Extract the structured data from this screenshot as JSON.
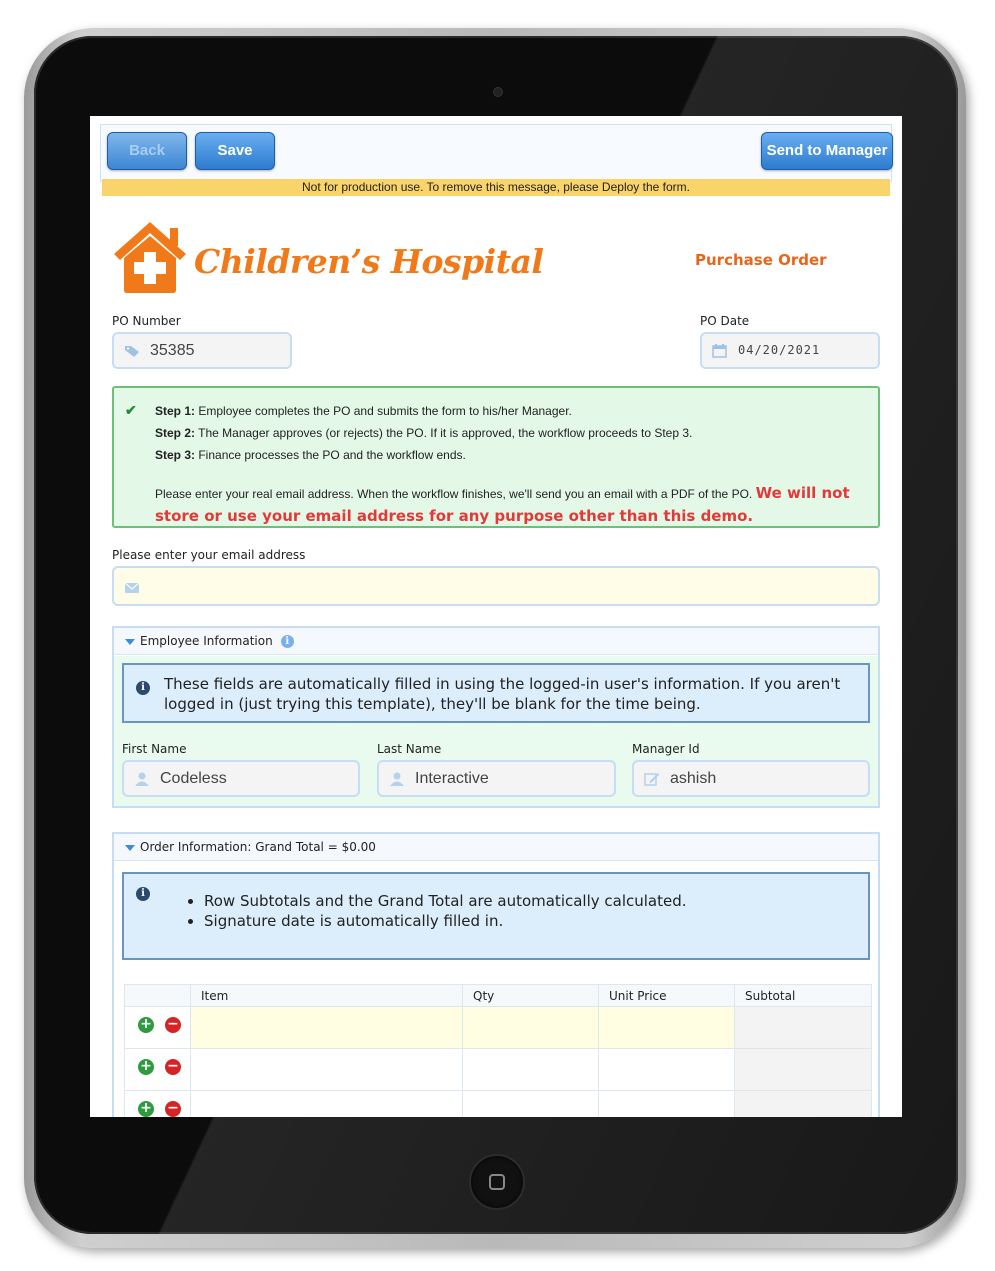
{
  "toolbar": {
    "back_label": "Back",
    "save_label": "Save",
    "send_label": "Send to Manager"
  },
  "warning": "Not for production use. To remove this message, please Deploy the form.",
  "header": {
    "hospital_name": "Children’s Hospital",
    "form_title": "Purchase Order"
  },
  "po": {
    "number_label": "PO Number",
    "number_value": "35385",
    "date_label": "PO Date",
    "date_value": "04/20/2021"
  },
  "steps": {
    "step1_label": "Step 1:",
    "step1_text": " Employee completes the PO and submits the form to his/her Manager.",
    "step2_label": "Step 2:",
    "step2_text": " The Manager approves (or rejects) the PO. If it is approved, the workflow proceeds to Step 3.",
    "step3_label": "Step 3:",
    "step3_text": " Finance processes the PO and the workflow ends.",
    "email_note": "Please enter your real email address. When the workflow finishes, we'll send you an email with a PDF of the PO. ",
    "email_warning": "We will not store or use your email address for any purpose other than this demo."
  },
  "email": {
    "label": "Please enter your email address",
    "value": ""
  },
  "employee": {
    "section_title": "Employee Information",
    "info_text": "These fields are automatically filled in using the logged-in user's information. If you aren't logged in (just trying this template), they'll be blank for the time being.",
    "first_name_label": "First Name",
    "first_name_value": "Codeless",
    "last_name_label": "Last Name",
    "last_name_value": "Interactive",
    "manager_label": "Manager Id",
    "manager_value": "ashish"
  },
  "order": {
    "section_title": "Order Information: Grand Total = $0.00",
    "bullets": [
      "Row Subtotals and the Grand Total are automatically calculated.",
      "Signature date is automatically filled in."
    ],
    "columns": [
      "Item",
      "Qty",
      "Unit Price",
      "Subtotal"
    ],
    "rows": [
      {
        "item": "",
        "qty": "",
        "unit_price": "",
        "subtotal": ""
      },
      {
        "item": "",
        "qty": "",
        "unit_price": "",
        "subtotal": ""
      },
      {
        "item": "",
        "qty": "",
        "unit_price": "",
        "subtotal": ""
      }
    ]
  },
  "icons": {
    "tag": "tag-icon",
    "calendar": "calendar-icon",
    "envelope": "envelope-icon",
    "user": "user-icon",
    "edit": "edit-icon",
    "check": "checkmark-icon",
    "info": "info-icon",
    "add": "add-row-icon",
    "remove": "remove-row-icon"
  },
  "colors": {
    "brand_orange": "#f07a1a",
    "button_blue": "#2d7bd0",
    "warning_yellow": "#f9d46a",
    "steps_green_bg": "#e4f8e8",
    "alert_red": "#e23a3a"
  }
}
